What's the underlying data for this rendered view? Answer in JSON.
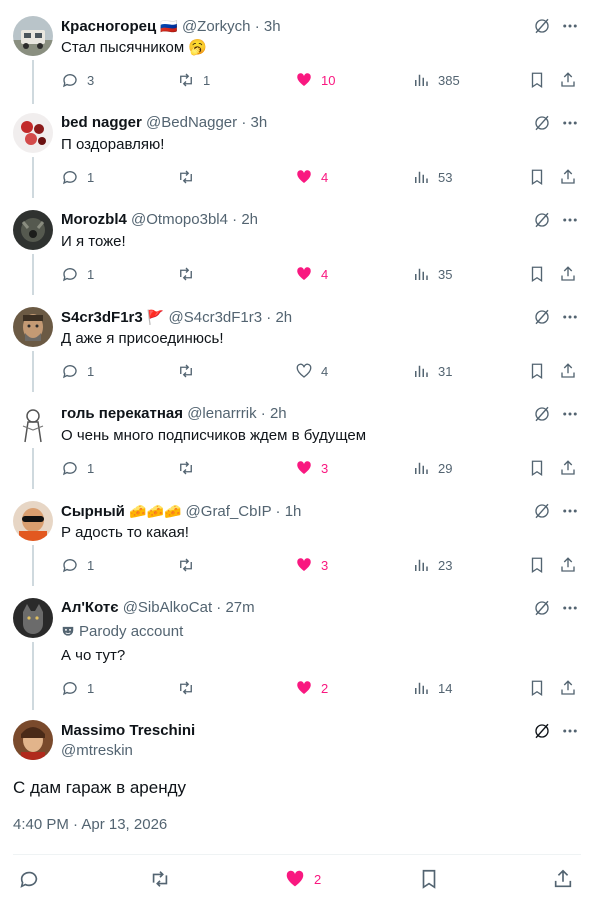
{
  "colors": {
    "like_pink": "#f91880",
    "muted_gray": "#536471",
    "text": "#0f1419",
    "thread_line": "#cfd9de"
  },
  "replies": [
    {
      "name": "Красногорец",
      "badge": "🇷🇺",
      "handle": "@Zorkych",
      "time": "3h",
      "text": "Стал пысячником 🥱",
      "stats": {
        "replies": "3",
        "reposts": "1",
        "likes": "10",
        "views": "385"
      },
      "liked": true
    },
    {
      "name": "bed nagger",
      "badge": "",
      "handle": "@BedNagger",
      "time": "3h",
      "text": "П оздоравляю!",
      "stats": {
        "replies": "1",
        "reposts": "",
        "likes": "4",
        "views": "53"
      },
      "liked": true
    },
    {
      "name": "Morozbl4",
      "badge": "",
      "handle": "@Otmoро3bl4",
      "time": "2h",
      "text": "И я тоже!",
      "stats": {
        "replies": "1",
        "reposts": "",
        "likes": "4",
        "views": "35"
      },
      "liked": true
    },
    {
      "name": "S4cr3dF1r3",
      "badge": "🚩",
      "handle": "@S4cr3dF1r3",
      "time": "2h",
      "text": "Д аже я присоединюсь!",
      "stats": {
        "replies": "1",
        "reposts": "",
        "likes": "4",
        "views": "31"
      },
      "liked": false
    },
    {
      "name": "голь перекатная",
      "badge": "",
      "handle": "@lenarrrik",
      "time": "2h",
      "text": "О чень много подписчиков ждем в будущем",
      "stats": {
        "replies": "1",
        "reposts": "",
        "likes": "3",
        "views": "29"
      },
      "liked": true
    },
    {
      "name": "Сырный",
      "badge": "🧀🧀🧀",
      "handle": "@Graf_CbIP",
      "time": "1h",
      "text": "Р адость то какая!",
      "stats": {
        "replies": "1",
        "reposts": "",
        "likes": "3",
        "views": "23"
      },
      "liked": true
    },
    {
      "name": "Ал'Котє",
      "badge": "",
      "handle": "@SibAlkoCat",
      "time": "27m",
      "parody": "Parody account",
      "text": "А чо тут?",
      "stats": {
        "replies": "1",
        "reposts": "",
        "likes": "2",
        "views": "14"
      },
      "liked": true
    }
  ],
  "main": {
    "name": "Massimo Treschini",
    "handle": "@mtreskin",
    "text": "С дам гараж в аренду",
    "timestamp": "4:40 PM · Apr 13, 2026",
    "likes": "2"
  }
}
